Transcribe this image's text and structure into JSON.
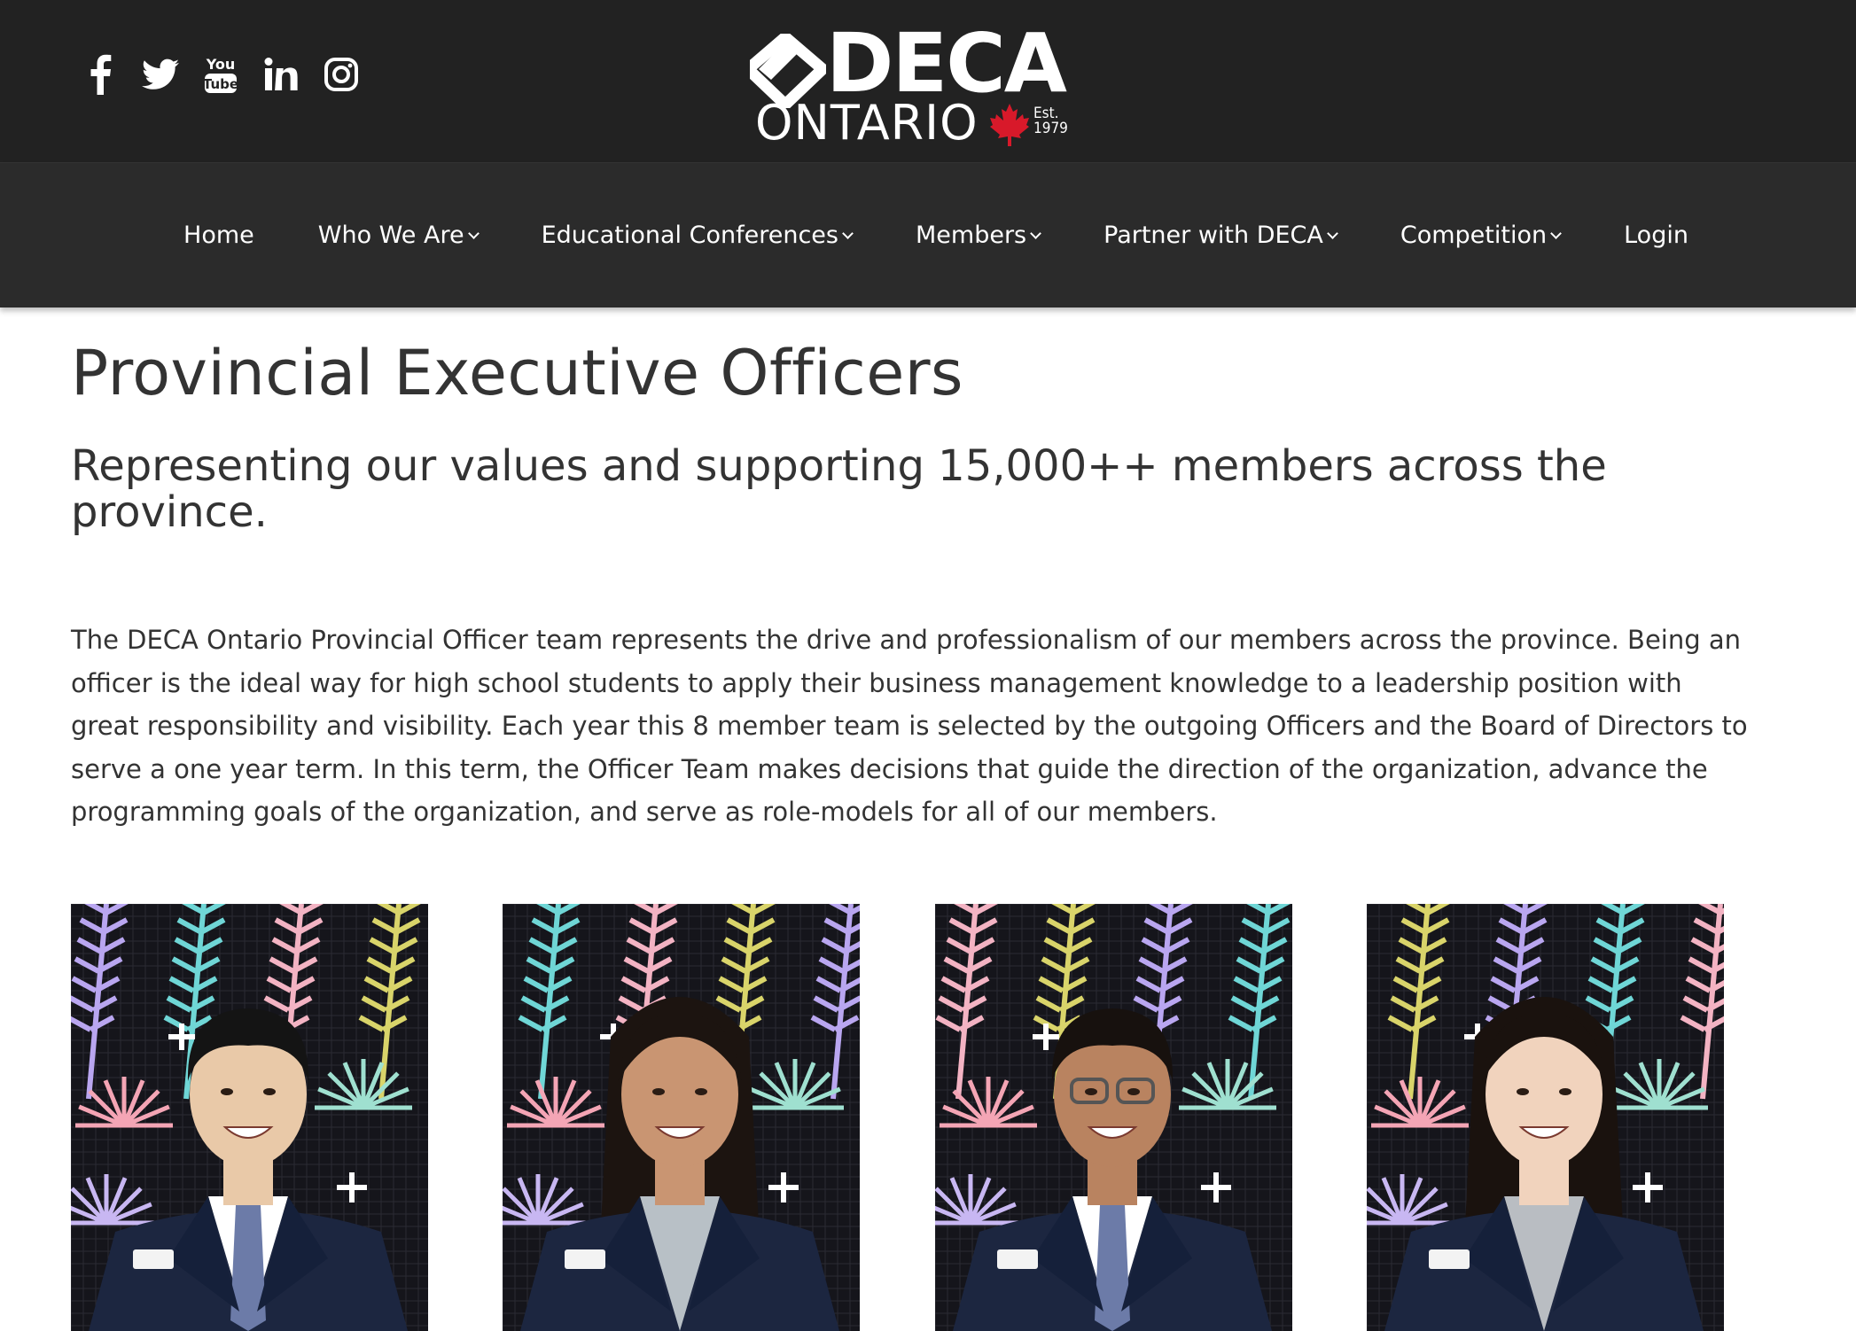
{
  "header": {
    "social": [
      {
        "name": "facebook-icon"
      },
      {
        "name": "twitter-icon"
      },
      {
        "name": "youtube-icon"
      },
      {
        "name": "linkedin-icon"
      },
      {
        "name": "instagram-icon"
      }
    ],
    "logo": {
      "deca": "DECA",
      "ontario": "ONTARIO",
      "est": "Est.",
      "year": "1979"
    }
  },
  "nav": {
    "items": [
      {
        "label": "Home",
        "dropdown": false
      },
      {
        "label": "Who We Are",
        "dropdown": true
      },
      {
        "label": "Educational Conferences",
        "dropdown": true
      },
      {
        "label": "Members",
        "dropdown": true
      },
      {
        "label": "Partner with DECA",
        "dropdown": true
      },
      {
        "label": "Competition",
        "dropdown": true
      },
      {
        "label": "Login",
        "dropdown": false
      }
    ]
  },
  "main": {
    "title": "Provincial Executive Officers",
    "subtitle": "Representing our values and supporting 15,000++ members across the province.",
    "intro": "The DECA Ontario Provincial Officer team represents the drive and professionalism of our members across the province.  Being an officer is the ideal way for high school students to apply their business management knowledge to a leadership position with great responsibility and visibility.  Each year this 8 member team is selected by the outgoing Officers and the Board of Directors to serve a one year term.  In this term, the Officer Team makes decisions that guide the direction of the organization, advance the programming goals of the organization, and serve as role-models for all of our members."
  },
  "officers": [
    {
      "photo": "officer-photo-1"
    },
    {
      "photo": "officer-photo-2"
    },
    {
      "photo": "officer-photo-3"
    },
    {
      "photo": "officer-photo-4"
    }
  ],
  "colors": {
    "topbar": "#222222",
    "navbar": "#2b2b2b",
    "text": "#333333",
    "leaf": "#d8192a"
  }
}
